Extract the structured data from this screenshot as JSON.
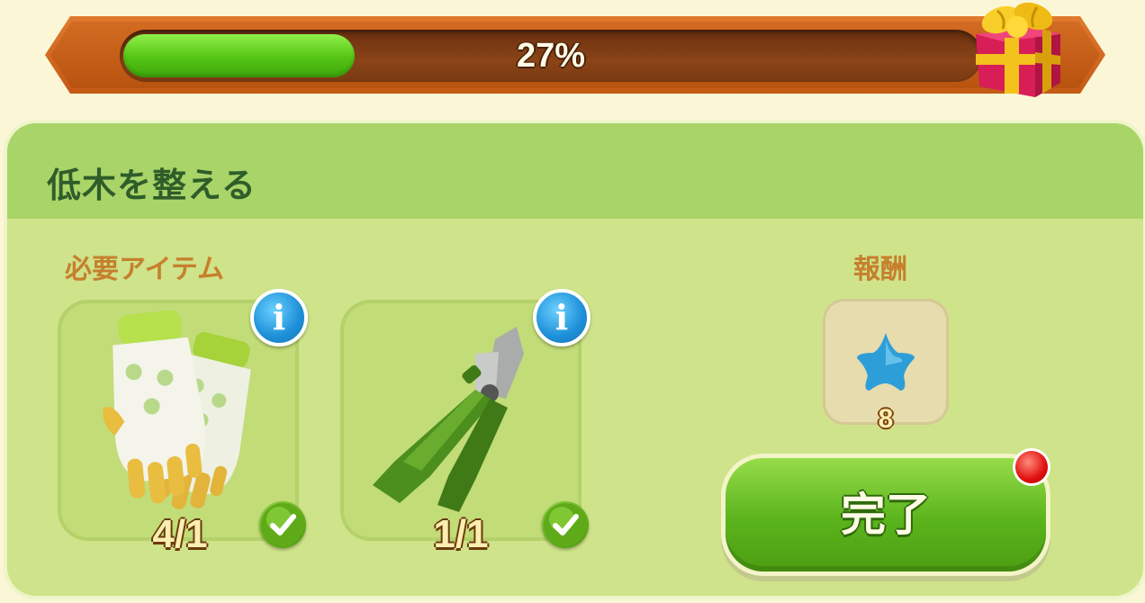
{
  "progress": {
    "value": 0.27,
    "label": "27%"
  },
  "quest": {
    "title": "低木を整える",
    "required_label": "必要アイテム",
    "reward_label": "報酬",
    "items": [
      {
        "name": "gloves",
        "count": "4/1",
        "complete": true
      },
      {
        "name": "pruning-shears",
        "count": "1/1",
        "complete": true
      }
    ],
    "reward": {
      "icon": "blue-star-icon",
      "amount": "8"
    },
    "complete_label": "完了"
  },
  "colors": {
    "progress_fill": "#54c414",
    "panel_bg": "#cfe38a",
    "panel_header_bg": "#a9d468",
    "title_color": "#2f5d2a",
    "section_label_color": "#c6802d",
    "info_button": "#1d8fd8",
    "complete_button": "#5ab41c",
    "notification_dot": "#e01010"
  }
}
